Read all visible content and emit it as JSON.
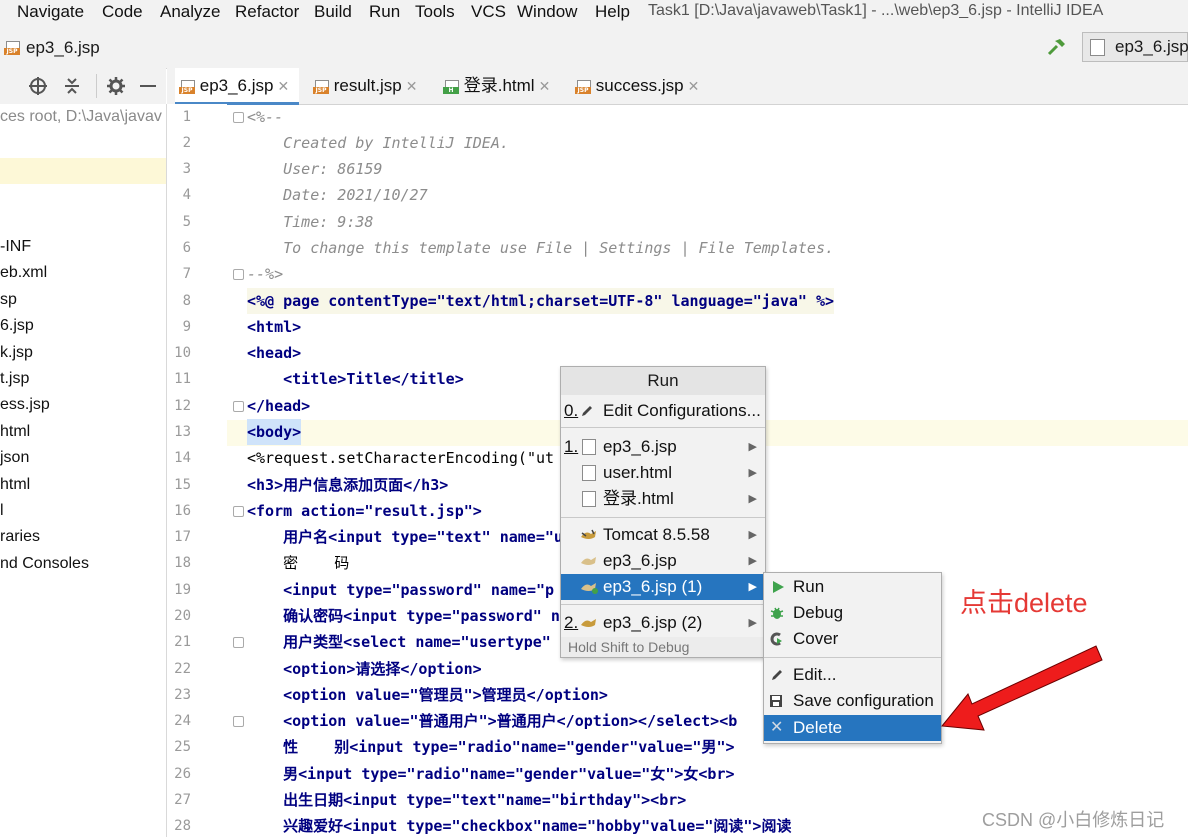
{
  "menu": {
    "items": [
      "Navigate",
      "Code",
      "Analyze",
      "Refactor",
      "Build",
      "Run",
      "Tools",
      "VCS",
      "Window",
      "Help"
    ],
    "window_title": "Task1 [D:\\Java\\javaweb\\Task1] - ...\\web\\ep3_6.jsp - IntelliJ IDEA"
  },
  "navbar": {
    "file": "ep3_6.jsp",
    "run_config": "ep3_6.jsp"
  },
  "project": {
    "root_text": "ces root,  D:\\Java\\javav",
    "items": [
      "-INF",
      "eb.xml",
      "sp",
      "6.jsp",
      "k.jsp",
      "t.jsp",
      "ess.jsp",
      "html",
      "json",
      "html",
      "l",
      "raries",
      "nd Consoles"
    ]
  },
  "tabs": [
    {
      "label": "ep3_6.jsp",
      "type": "jsp",
      "active": true
    },
    {
      "label": "result.jsp",
      "type": "jsp",
      "active": false
    },
    {
      "label": "登录.html",
      "type": "html",
      "active": false
    },
    {
      "label": "success.jsp",
      "type": "jsp",
      "active": false
    }
  ],
  "code": {
    "line_numbers": [
      "1",
      "2",
      "3",
      "4",
      "5",
      "6",
      "7",
      "8",
      "9",
      "10",
      "11",
      "12",
      "13",
      "14",
      "15",
      "16",
      "17",
      "18",
      "19",
      "20",
      "21",
      "22",
      "23",
      "24",
      "25",
      "26",
      "27",
      "28"
    ],
    "lines": [
      "<%--",
      "    Created by IntelliJ IDEA.",
      "    User: 86159",
      "    Date: 2021/10/27",
      "    Time: 9:38",
      "    To change this template use File | Settings | File Templates.",
      "--%>",
      "<%@ page contentType=\"text/html;charset=UTF-8\" language=\"java\" %>",
      "<html>",
      "<head>",
      "    <title>Title</title>",
      "</head>",
      "<body>",
      "<%request.setCharacterEncoding(\"ut",
      "<h3>用户信息添加页面</h3>",
      "<form action=\"result.jsp\">",
      "    用户名<input type=\"text\" name=\"u",
      "    密    码",
      "    <input type=\"password\" name=\"p",
      "    确认密码<input type=\"password\" n",
      "    用户类型<select name=\"usertype\"",
      "    <option>请选择</option>",
      "    <option value=\"管理员\">管理员</option>",
      "    <option value=\"普通用户\">普通用户</option></select><b",
      "    性    别<input type=\"radio\"name=\"gender\"value=\"男\">",
      "    男<input type=\"radio\"name=\"gender\"value=\"女\">女<br>",
      "    出生日期<input type=\"text\"name=\"birthday\"><br>",
      "    兴趣爱好<input type=\"checkbox\"name=\"hobby\"value=\"阅读\">阅读"
    ]
  },
  "run_popup": {
    "title": "Run",
    "edit_config": {
      "index": "0.",
      "label": "Edit Configurations..."
    },
    "items": [
      {
        "index": "1.",
        "label": "ep3_6.jsp",
        "icon": "file-icon"
      },
      {
        "index": "",
        "label": "user.html",
        "icon": "file-icon"
      },
      {
        "index": "",
        "label": "登录.html",
        "icon": "file-icon"
      },
      {
        "index": "",
        "label": "Tomcat 8.5.58",
        "icon": "tomcat-icon"
      },
      {
        "index": "",
        "label": "ep3_6.jsp",
        "icon": "tomcat-icon"
      },
      {
        "index": "",
        "label": "ep3_6.jsp (1)",
        "icon": "tomcat-icon",
        "selected": true
      },
      {
        "index": "2.",
        "label": "ep3_6.jsp (2)",
        "icon": "tomcat-icon"
      }
    ],
    "hint": "Hold Shift to Debug"
  },
  "submenu": {
    "items": [
      {
        "label": "Run",
        "icon": "run-icon"
      },
      {
        "label": "Debug",
        "icon": "debug-icon"
      },
      {
        "label": "Cover",
        "icon": "cover-icon"
      },
      {
        "label": "Edit...",
        "icon": "edit-icon"
      },
      {
        "label": "Save configuration",
        "icon": "save-icon"
      },
      {
        "label": "Delete",
        "icon": "delete-icon",
        "selected": true
      }
    ]
  },
  "annotation": {
    "text": "点击delete",
    "color": "#e53935"
  },
  "watermark": "CSDN @小白修炼日记",
  "colors": {
    "selection": "#2675bf",
    "tag": "#000080",
    "attr": "#0000ff",
    "string": "#008000",
    "comment": "#8c8c8c"
  }
}
